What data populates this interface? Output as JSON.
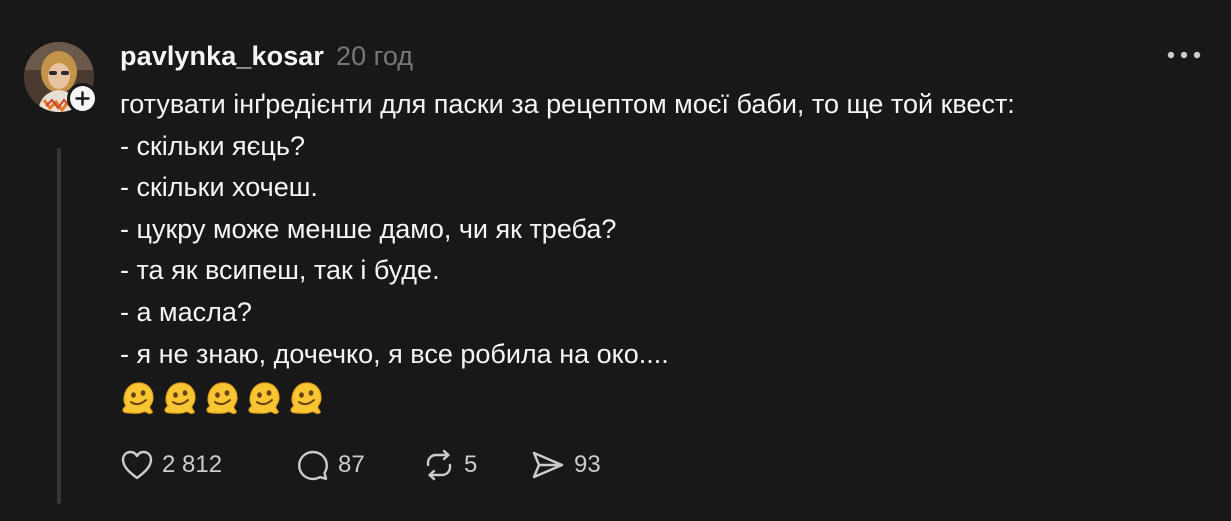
{
  "post": {
    "username": "pavlynka_kosar",
    "timestamp": "20 год",
    "lines": [
      "готувати інґредієнти для паски за рецептом моєї баби, то ще той квест:",
      "- скільки яєць?",
      "- скільки хочеш.",
      "- цукру може менше дамо, чи як треба?",
      "- та як всипеш, так і буде.",
      "- а масла?",
      "- я не знаю, дочечко, я все робила на око...."
    ],
    "emojis": [
      "melting-face",
      "melting-face",
      "melting-face",
      "melting-face",
      "melting-face"
    ],
    "stats": {
      "likes": "2 812",
      "replies": "87",
      "reposts": "5",
      "shares": "93"
    }
  },
  "icons": {
    "like": "heart-icon",
    "reply": "comment-icon",
    "repost": "repost-icon",
    "share": "send-icon",
    "more": "more-icon",
    "follow": "plus-icon"
  },
  "colors": {
    "background": "#181818",
    "text": "#f3f5f7",
    "muted": "#777777",
    "thread_line": "#333638"
  }
}
